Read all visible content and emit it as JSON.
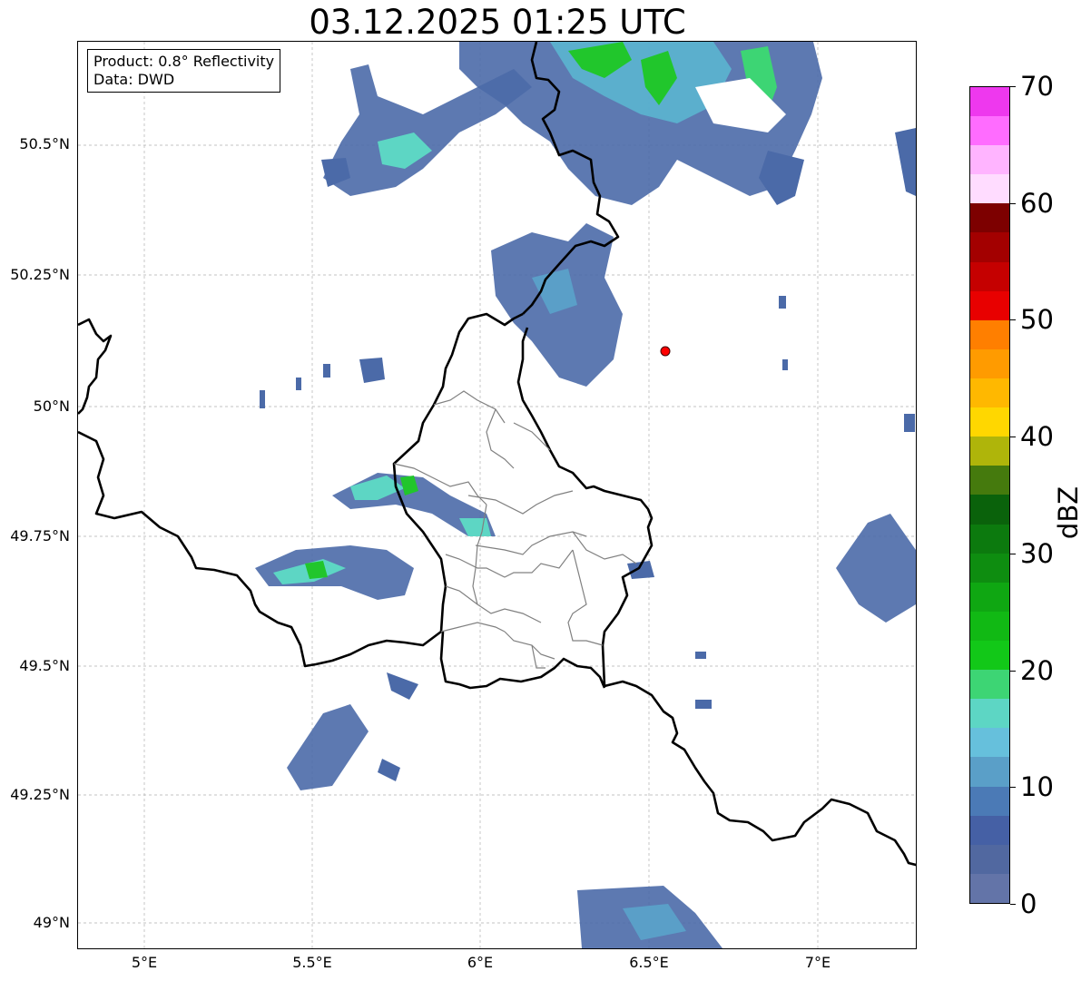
{
  "title": "03.12.2025 01:25 UTC",
  "info": {
    "product": "Product: 0.8° Reflectivity",
    "data": "Data: DWD"
  },
  "map": {
    "lon_range": [
      4.8,
      7.3
    ],
    "lat_range": [
      48.95,
      50.7
    ],
    "lat_ticks": [
      "50.5°N",
      "50.25°N",
      "50°N",
      "49.75°N",
      "49.5°N",
      "49.25°N",
      "49°N"
    ],
    "lon_ticks": [
      "5°E",
      "5.5°E",
      "6°E",
      "6.5°E",
      "7°E"
    ],
    "grid": true,
    "radar_site_color": "#ff0000",
    "border_color": "#000000",
    "admin_border_color": "#808080"
  },
  "colorbar": {
    "label": "dBZ",
    "min": 0,
    "max": 70,
    "step": 2.5,
    "tick_labels": [
      "0",
      "10",
      "20",
      "30",
      "40",
      "50",
      "60",
      "70"
    ],
    "colors": [
      "#6374a8",
      "#5168a0",
      "#4560a5",
      "#4b7ab6",
      "#5a9fc8",
      "#66c0dc",
      "#5dd6c4",
      "#3dd574",
      "#12c818",
      "#11b914",
      "#0fa712",
      "#0e8d10",
      "#0c7a0e",
      "#0a620b",
      "#457a0d",
      "#afb50a",
      "#ffd700",
      "#ffb800",
      "#ff9b00",
      "#ff7f00",
      "#e80000",
      "#c50000",
      "#a30000",
      "#7d0000",
      "#ffdcff",
      "#ffb4ff",
      "#ff6cff",
      "#ee38ee"
    ]
  }
}
